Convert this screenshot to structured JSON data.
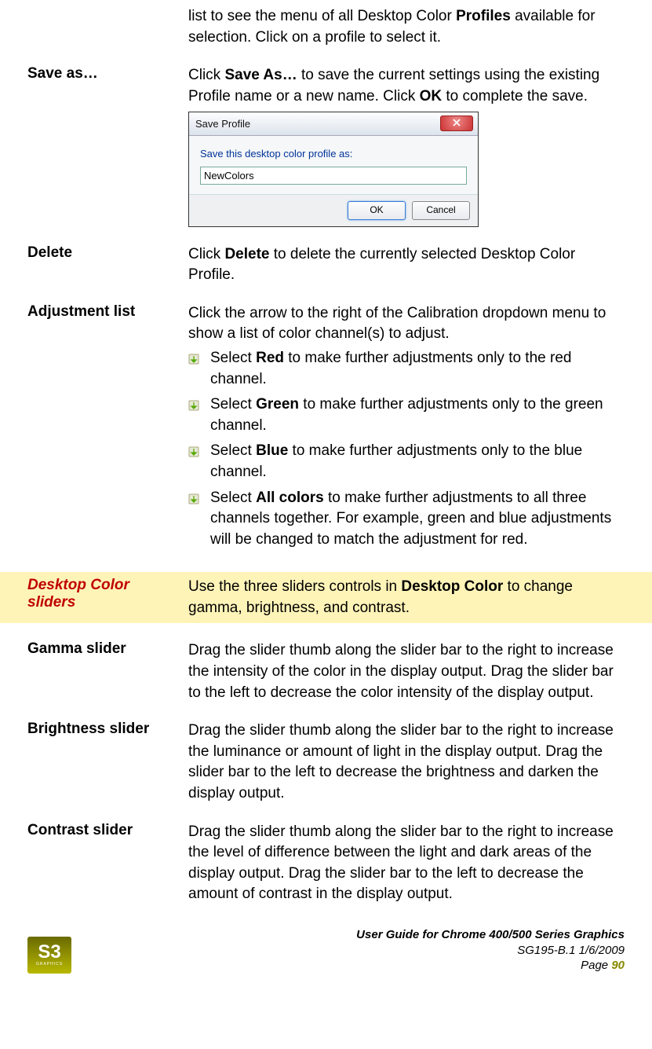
{
  "intro": {
    "text_before": "list to see the menu of all Desktop Color ",
    "bold1": "Profiles",
    "text_after": " available for selection. Click on a profile to select it."
  },
  "save_as": {
    "label": "Save as…",
    "p1": "Click ",
    "b1": "Save As…",
    "p2": " to save the current settings using the existing Profile name or a new name. Click ",
    "b2": "OK",
    "p3": " to complete the save."
  },
  "dialog": {
    "title": "Save Profile",
    "prompt": "Save this desktop color profile as:",
    "input_value": "NewColors",
    "ok": "OK",
    "cancel": "Cancel"
  },
  "delete": {
    "label": "Delete",
    "p1": "Click ",
    "b1": "Delete",
    "p2": " to delete the currently selected Desktop Color Profile."
  },
  "adjustment": {
    "label": "Adjustment list",
    "intro": "Click the arrow to the right of the Calibration dropdown menu to show a list of color channel(s) to adjust.",
    "items": [
      {
        "pre": "Select ",
        "bold": "Red",
        "post": " to make further adjustments only to the red channel."
      },
      {
        "pre": "Select ",
        "bold": "Green",
        "post": " to make further adjustments only to the green channel."
      },
      {
        "pre": "Select ",
        "bold": "Blue",
        "post": " to make further adjustments only to the blue channel."
      },
      {
        "pre": "Select ",
        "bold": "All colors",
        "post": " to make further adjustments to all three channels together. For example, green and blue adjustments will be changed to match the adjustment for red."
      }
    ]
  },
  "desktop_color": {
    "label": "Desktop Color sliders",
    "p1": "Use the three sliders controls in ",
    "b1": "Desktop Color",
    "p2": " to change gamma, brightness, and contrast."
  },
  "gamma": {
    "label": "Gamma slider",
    "text": "Drag the slider thumb along the slider bar to the right to increase the intensity of the color in the display output. Drag the slider bar to the left to decrease the color intensity of the display output."
  },
  "brightness": {
    "label": "Brightness slider",
    "text": "Drag the slider thumb along the slider bar to the right to increase the luminance or amount of light in the display output. Drag the slider bar to the left to decrease the brightness and darken the display output."
  },
  "contrast": {
    "label": "Contrast slider",
    "text": "Drag the slider thumb along the slider bar to the right to increase the level of difference between the light and dark areas of the display output. Drag the slider bar to the left to decrease the amount of contrast in the display output."
  },
  "footer": {
    "logo_main": "S3",
    "logo_sub": "GRAPHICS",
    "title": "User Guide for Chrome 400/500 Series Graphics",
    "doc": "SG195-B.1   1/6/2009",
    "page_label": "Page ",
    "page_num": "90"
  }
}
